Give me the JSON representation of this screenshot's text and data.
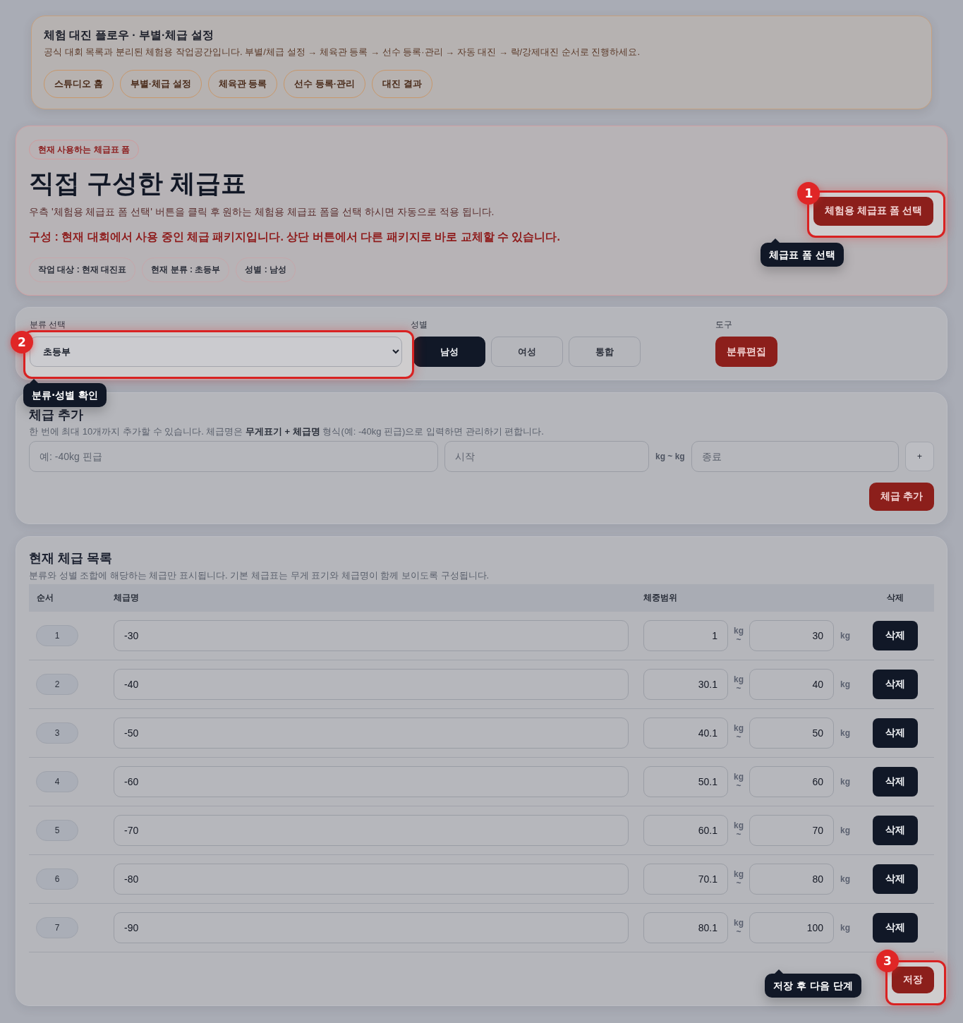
{
  "flow_panel": {
    "title": "체험 대진 플로우 · 부별·체급 설정",
    "description": "공식 대회 목록과 분리된 체험용 작업공간입니다. 부별/체급 설정 → 체육관 등록 → 선수 등록·관리 → 자동 대진 → 락/강제대진 순서로 진행하세요.",
    "steps": [
      "스튜디오 홈",
      "부별·체급 설정",
      "체육관 등록",
      "선수 등록·관리",
      "대진 결과"
    ]
  },
  "template_card": {
    "tag": "현재 사용하는 체급표 폼",
    "title": "직접 구성한 체급표",
    "description": "우측 '체험용 체급표 폼 선택' 버튼을 클릭 후 원하는 체험용 체급표 폼을 선택 하시면 자동으로 적용 됩니다.",
    "composition": "구성 : 현재 대회에서 사용 중인 체급 패키지입니다. 상단 버튼에서 다른 패키지로 바로 교체할 수 있습니다.",
    "chips": [
      "작업 대상 : 현재 대진표",
      "현재 분류 : 초등부",
      "성별 : 남성"
    ],
    "select_button": "체험용 체급표 폼 선택"
  },
  "filters": {
    "division": {
      "label": "분류 선택",
      "value": "초등부"
    },
    "gender": {
      "label": "성별",
      "options": [
        {
          "label": "남성",
          "selected": true
        },
        {
          "label": "여성",
          "selected": false
        },
        {
          "label": "통합",
          "selected": false
        }
      ]
    },
    "tools": {
      "label": "도구",
      "button": "분류편집"
    }
  },
  "add_class": {
    "title": "체급 추가",
    "description": "한 번에 최대 10개까지 추가할 수 있습니다. 체급명은 **무게표기 + 체급명** 형식(예: -40kg 핀급)으로 입력하면 관리하기 편합니다.",
    "name_placeholder": "예: -40kg 핀급",
    "start_placeholder": "시작",
    "range_unit": "kg ~ kg",
    "end_placeholder": "종료",
    "plus_button": "+",
    "add_button": "체급 추가"
  },
  "class_list": {
    "title": "현재 체급 목록",
    "description": "분류와 성별 조합에 해당하는 체급만 표시됩니다. 기본 체급표는 무게 표기와 체급명이 함께 보이도록 구성됩니다.",
    "columns": [
      "순서",
      "체급명",
      "체중범위",
      "삭제"
    ],
    "rows": [
      {
        "order": "1",
        "name": "-30",
        "min": "1",
        "min_unit": "kg",
        "separator": "~",
        "max": "30",
        "max_unit": "kg",
        "delete": "삭제"
      },
      {
        "order": "2",
        "name": "-40",
        "min": "30.1",
        "min_unit": "kg",
        "separator": "~",
        "max": "40",
        "max_unit": "kg",
        "delete": "삭제"
      },
      {
        "order": "3",
        "name": "-50",
        "min": "40.1",
        "min_unit": "kg",
        "separator": "~",
        "max": "50",
        "max_unit": "kg",
        "delete": "삭제"
      },
      {
        "order": "4",
        "name": "-60",
        "min": "50.1",
        "min_unit": "kg",
        "separator": "~",
        "max": "60",
        "max_unit": "kg",
        "delete": "삭제"
      },
      {
        "order": "5",
        "name": "-70",
        "min": "60.1",
        "min_unit": "kg",
        "separator": "~",
        "max": "70",
        "max_unit": "kg",
        "delete": "삭제"
      },
      {
        "order": "6",
        "name": "-80",
        "min": "70.1",
        "min_unit": "kg",
        "separator": "~",
        "max": "80",
        "max_unit": "kg",
        "delete": "삭제"
      },
      {
        "order": "7",
        "name": "-90",
        "min": "80.1",
        "min_unit": "kg",
        "separator": "~",
        "max": "100",
        "max_unit": "kg",
        "delete": "삭제"
      }
    ],
    "save_button": "저장"
  },
  "guide": {
    "steps": [
      {
        "number": "1",
        "tip": "체급표 폼 선택"
      },
      {
        "number": "2",
        "tip": "분류·성별 확인"
      },
      {
        "number": "3",
        "tip": "저장 후 다음 단계"
      }
    ]
  }
}
